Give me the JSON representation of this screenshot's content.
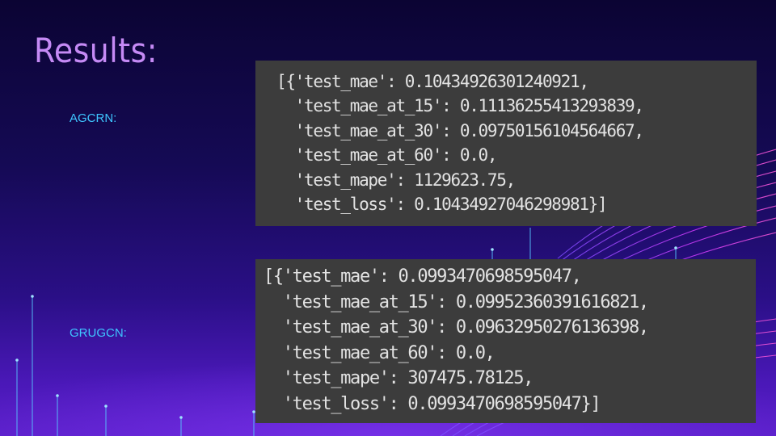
{
  "slide": {
    "title": "Results:"
  },
  "sections": [
    {
      "label": "AGCRN:",
      "code_lines": [
        "[{'test_mae': 0.10434926301240921,",
        "  'test_mae_at_15': 0.11136255413293839,",
        "  'test_mae_at_30': 0.09750156104564667,",
        "  'test_mae_at_60': 0.0,",
        "  'test_mape': 1129623.75,",
        "  'test_loss': 0.10434927046298981}]"
      ]
    },
    {
      "label": "GRUGCN:",
      "code_lines": [
        "[{'test_mae': 0.0993470698595047,",
        "  'test_mae_at_15': 0.09952360391616821,",
        "  'test_mae_at_30': 0.09632950276136398,",
        "  'test_mae_at_60': 0.0,",
        "  'test_mape': 307475.78125,",
        "  'test_loss': 0.0993470698595047}]"
      ]
    }
  ],
  "colors": {
    "title": "#c58af5",
    "label": "#3ec5ff",
    "code_background": "#3c3c3c",
    "code_text": "#e2e2e2"
  }
}
